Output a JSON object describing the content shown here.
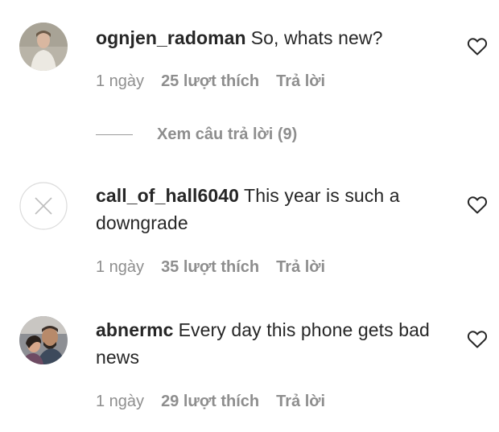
{
  "comments": [
    {
      "username": "ognjen_radoman",
      "text": "So, whats new?",
      "time": "1 ngày",
      "likes": "25 lượt thích",
      "reply_label": "Trả lời",
      "avatar": "user-photo-avatar",
      "like_icon": "heart-outline-icon"
    },
    {
      "username": "call_of_hall6040",
      "text": "This year is such a downgrade",
      "time": "1 ngày",
      "likes": "35 lượt thích",
      "reply_label": "Trả lời",
      "avatar": "deleted-user-x-avatar",
      "like_icon": "heart-outline-icon"
    },
    {
      "username": "abnermc",
      "text": "Every day this phone gets bad news",
      "time": "1 ngày",
      "likes": "29 lượt thích",
      "reply_label": "Trả lời",
      "avatar": "couple-photo-avatar",
      "like_icon": "heart-outline-icon"
    }
  ],
  "view_replies": {
    "label": "Xem câu trả lời (9)"
  },
  "colors": {
    "text": "#262626",
    "secondary": "#8e8e8e",
    "background": "#ffffff"
  }
}
